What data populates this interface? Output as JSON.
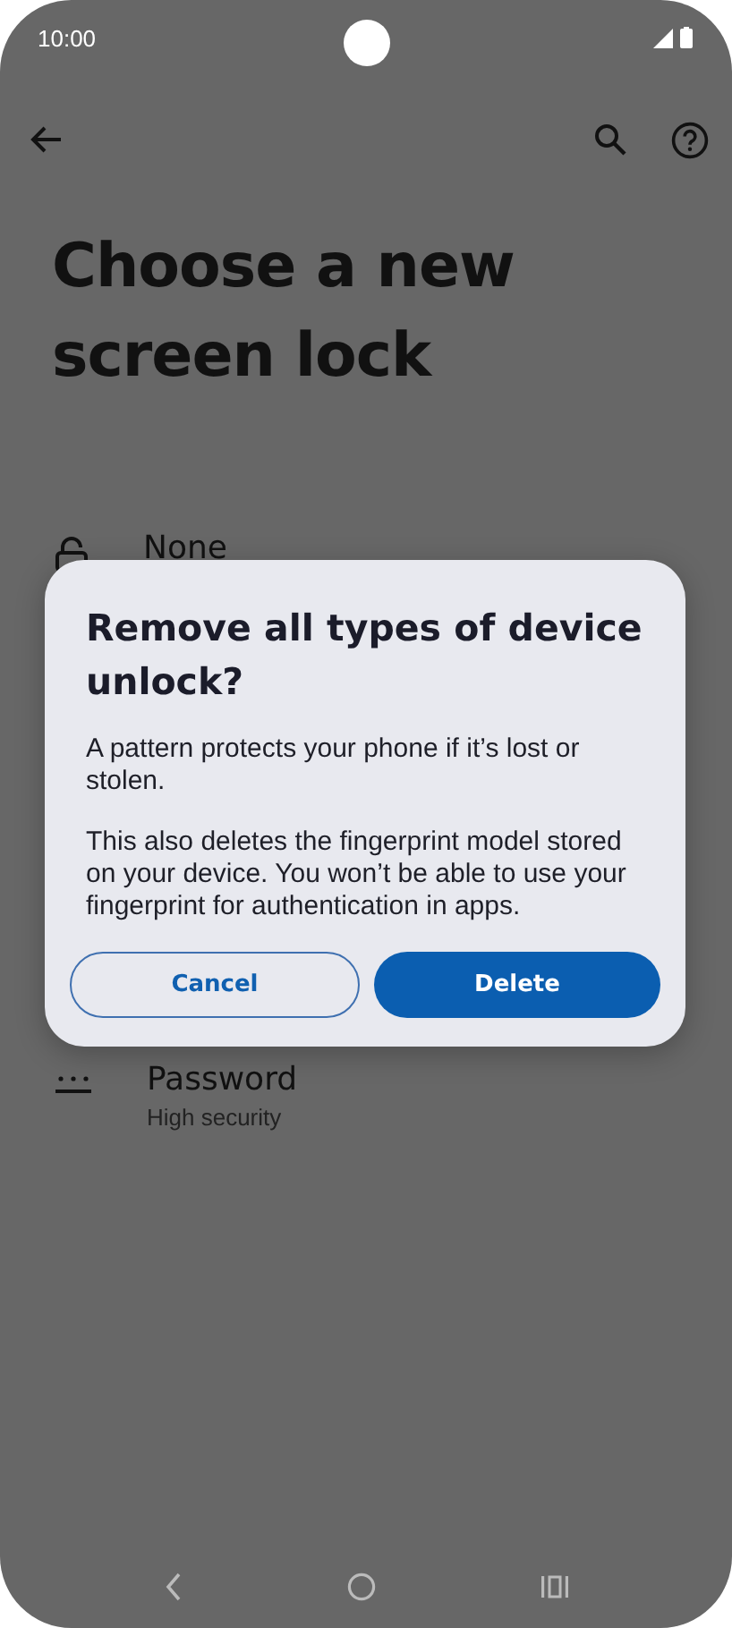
{
  "status_bar": {
    "time": "10:00"
  },
  "page": {
    "title": "Choose a new screen lock"
  },
  "options": [
    {
      "kind": "none",
      "title": "None"
    },
    {
      "kind": "password",
      "title": "Password",
      "subtitle": "High security"
    }
  ],
  "dialog": {
    "title": "Remove all types of device unlock?",
    "paragraphs": [
      "A pattern protects your phone if it’s lost or stolen.",
      "This also deletes the fingerprint model stored on your device. You won’t be able to use your fingerprint for authentication in apps."
    ],
    "buttons": [
      {
        "label": "Cancel",
        "kind": "outlined"
      },
      {
        "label": "Delete",
        "kind": "filled"
      }
    ]
  }
}
